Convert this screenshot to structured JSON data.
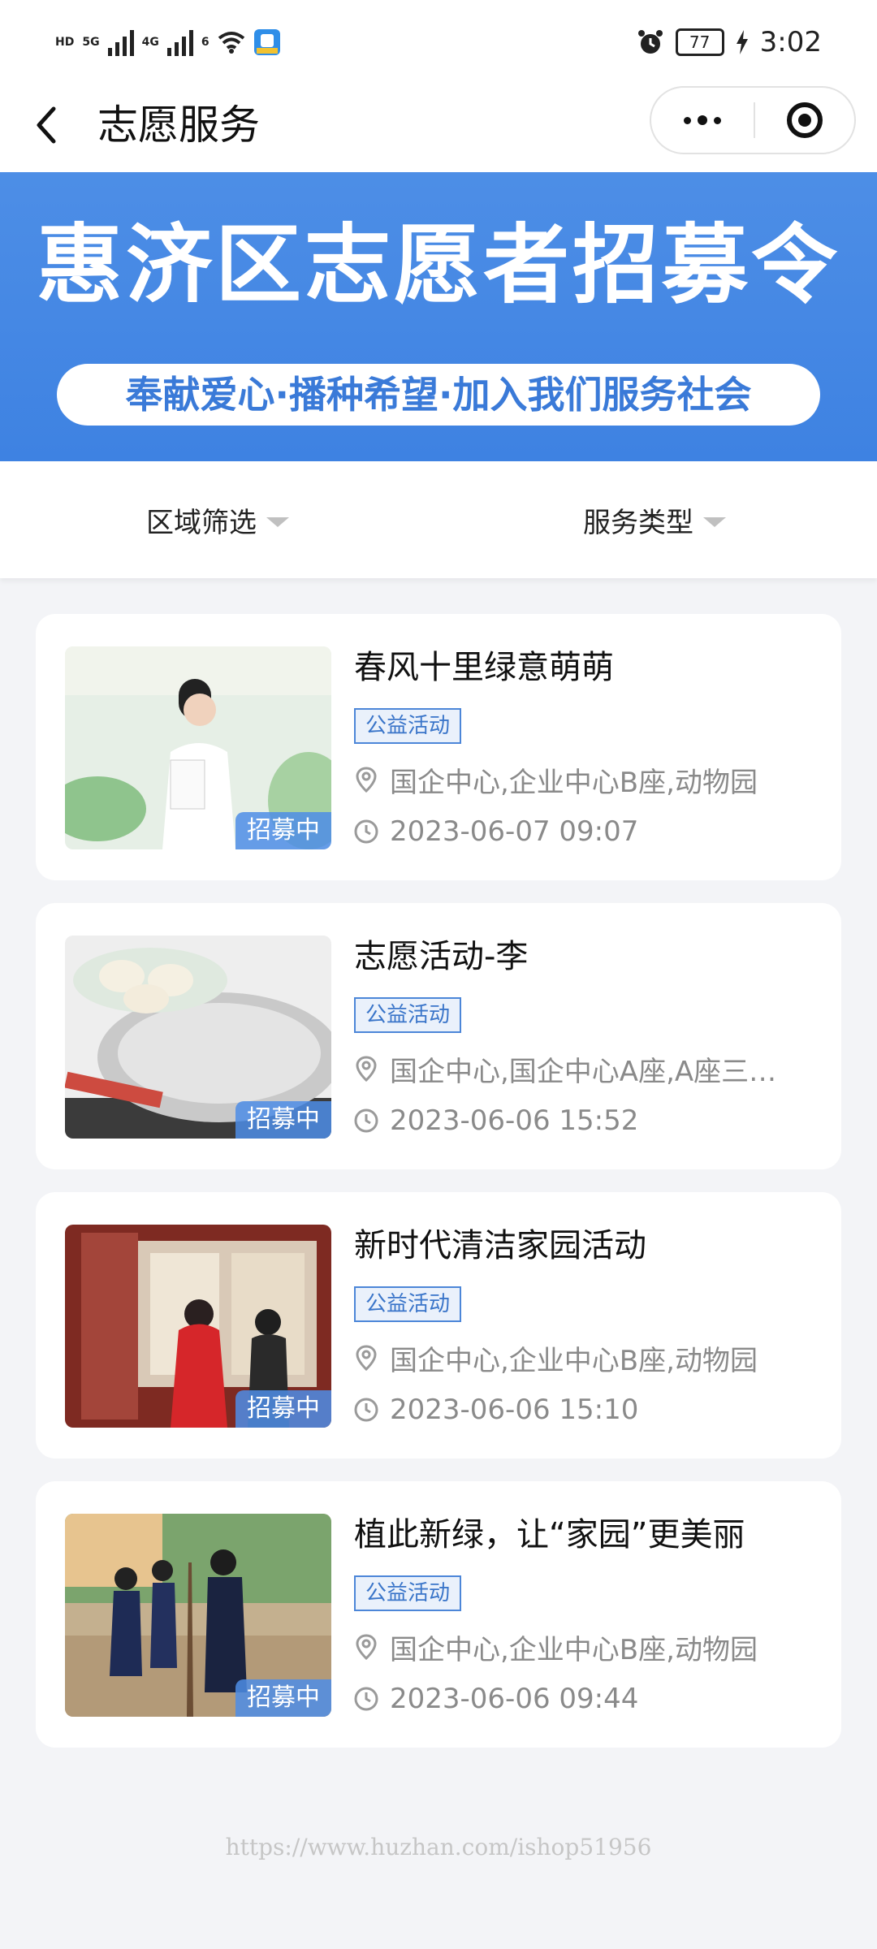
{
  "statusbar": {
    "hd1": "HD",
    "net1": "5G",
    "net2": "4G",
    "wifi_sup": "6",
    "battery": "77",
    "time": "3:02"
  },
  "nav": {
    "title": "志愿服务"
  },
  "banner": {
    "title": "惠济区志愿者招募令",
    "subtitle": "奉献爱心·播种希望·加入我们服务社会"
  },
  "filters": {
    "area": "区域筛选",
    "type": "服务类型"
  },
  "cards": [
    {
      "title": "春风十里绿意萌萌",
      "tag": "公益活动",
      "location": "国企中心,企业中心B座,动物园",
      "time": "2023-06-07 09:07",
      "badge": "招募中"
    },
    {
      "title": "志愿活动-李",
      "tag": "公益活动",
      "location": "国企中心,国企中心A座,A座三…",
      "time": "2023-06-06 15:52",
      "badge": "招募中"
    },
    {
      "title": "新时代清洁家园活动",
      "tag": "公益活动",
      "location": "国企中心,企业中心B座,动物园",
      "time": "2023-06-06 15:10",
      "badge": "招募中"
    },
    {
      "title": "植此新绿，让“家园”更美丽",
      "tag": "公益活动",
      "location": "国企中心,企业中心B座,动物园",
      "time": "2023-06-06 09:44",
      "badge": "招募中"
    }
  ],
  "watermark": "https://www.huzhan.com/ishop51956",
  "colors": {
    "accent": "#4a8be4",
    "tag_border": "#4c86d8"
  }
}
